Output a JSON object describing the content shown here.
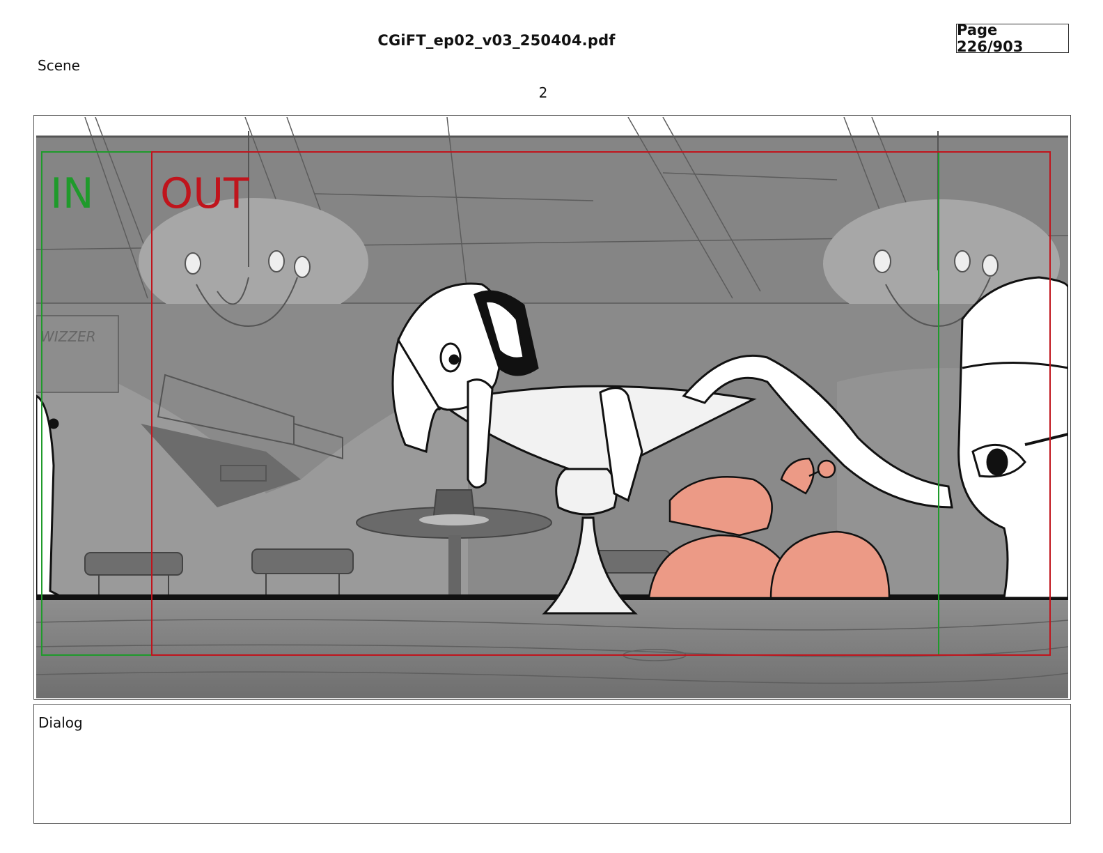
{
  "header": {
    "file_title": "CGiFT_ep02_v03_250404.pdf",
    "page_label": "Page 226/903"
  },
  "scene": {
    "label": "Scene",
    "number": "2"
  },
  "frame": {
    "in_label": "IN",
    "out_label": "OUT",
    "sign_text": "WIZZER",
    "colors": {
      "in_marker": "#1f9a2b",
      "out_marker": "#c0141c",
      "background": "#7a7a7a",
      "crab": "#ec9a86",
      "bar_top": "#111111"
    }
  },
  "dialog": {
    "label": "Dialog",
    "text": ""
  }
}
